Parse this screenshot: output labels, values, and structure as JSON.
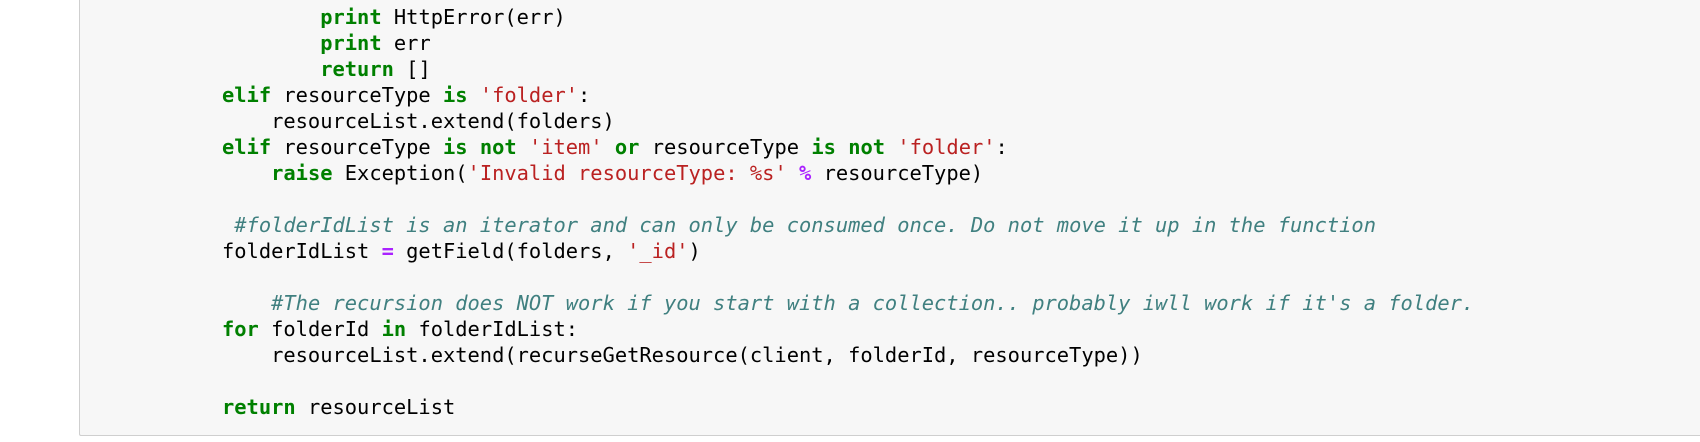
{
  "colors": {
    "keyword": "#008000",
    "string": "#ba2121",
    "operator": "#aa22ff",
    "comment": "#408080",
    "cell_background": "#f7f7f7",
    "cell_border": "#cfcfcf"
  },
  "code_lines": [
    [
      {
        "t": "        ",
        "c": "p"
      },
      {
        "t": "print",
        "c": "kw"
      },
      {
        "t": " HttpError(err)",
        "c": "p"
      }
    ],
    [
      {
        "t": "        ",
        "c": "p"
      },
      {
        "t": "print",
        "c": "kw"
      },
      {
        "t": " err",
        "c": "p"
      }
    ],
    [
      {
        "t": "        ",
        "c": "p"
      },
      {
        "t": "return",
        "c": "kw"
      },
      {
        "t": " []",
        "c": "p"
      }
    ],
    [
      {
        "t": "elif",
        "c": "kw"
      },
      {
        "t": " resourceType ",
        "c": "p"
      },
      {
        "t": "is",
        "c": "kw"
      },
      {
        "t": " ",
        "c": "p"
      },
      {
        "t": "'folder'",
        "c": "str"
      },
      {
        "t": ":",
        "c": "p"
      }
    ],
    [
      {
        "t": "    resourceList.extend(folders)",
        "c": "p"
      }
    ],
    [
      {
        "t": "elif",
        "c": "kw"
      },
      {
        "t": " resourceType ",
        "c": "p"
      },
      {
        "t": "is",
        "c": "kw"
      },
      {
        "t": " ",
        "c": "p"
      },
      {
        "t": "not",
        "c": "kw"
      },
      {
        "t": " ",
        "c": "p"
      },
      {
        "t": "'item'",
        "c": "str"
      },
      {
        "t": " ",
        "c": "p"
      },
      {
        "t": "or",
        "c": "kw"
      },
      {
        "t": " resourceType ",
        "c": "p"
      },
      {
        "t": "is",
        "c": "kw"
      },
      {
        "t": " ",
        "c": "p"
      },
      {
        "t": "not",
        "c": "kw"
      },
      {
        "t": " ",
        "c": "p"
      },
      {
        "t": "'folder'",
        "c": "str"
      },
      {
        "t": ":",
        "c": "p"
      }
    ],
    [
      {
        "t": "    ",
        "c": "p"
      },
      {
        "t": "raise",
        "c": "kw"
      },
      {
        "t": " Exception(",
        "c": "p"
      },
      {
        "t": "'Invalid resourceType: %s'",
        "c": "str"
      },
      {
        "t": " ",
        "c": "p"
      },
      {
        "t": "%",
        "c": "op"
      },
      {
        "t": " resourceType)",
        "c": "p"
      }
    ],
    [],
    [
      {
        "t": " ",
        "c": "p"
      },
      {
        "t": "#folderIdList is an iterator and can only be consumed once. Do not move it up in the function",
        "c": "cm"
      }
    ],
    [
      {
        "t": "folderIdList ",
        "c": "p"
      },
      {
        "t": "=",
        "c": "op"
      },
      {
        "t": " getField(folders, ",
        "c": "p"
      },
      {
        "t": "'_id'",
        "c": "str"
      },
      {
        "t": ")",
        "c": "p"
      }
    ],
    [],
    [
      {
        "t": "    ",
        "c": "p"
      },
      {
        "t": "#The recursion does NOT work if you start with a collection.. probably iwll work if it's a folder.",
        "c": "cm"
      }
    ],
    [
      {
        "t": "for",
        "c": "kw"
      },
      {
        "t": " folderId ",
        "c": "p"
      },
      {
        "t": "in",
        "c": "kw"
      },
      {
        "t": " folderIdList:",
        "c": "p"
      }
    ],
    [
      {
        "t": "    resourceList.extend(recurseGetResource(client, folderId, resourceType))",
        "c": "p"
      }
    ],
    [],
    [
      {
        "t": "return",
        "c": "kw"
      },
      {
        "t": " resourceList",
        "c": "p"
      }
    ]
  ]
}
